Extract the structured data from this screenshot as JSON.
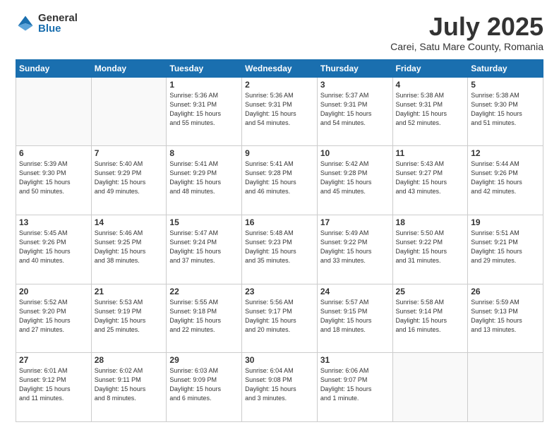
{
  "logo": {
    "general": "General",
    "blue": "Blue"
  },
  "header": {
    "month": "July 2025",
    "location": "Carei, Satu Mare County, Romania"
  },
  "weekdays": [
    "Sunday",
    "Monday",
    "Tuesday",
    "Wednesday",
    "Thursday",
    "Friday",
    "Saturday"
  ],
  "weeks": [
    [
      {
        "day": "",
        "info": ""
      },
      {
        "day": "",
        "info": ""
      },
      {
        "day": "1",
        "info": "Sunrise: 5:36 AM\nSunset: 9:31 PM\nDaylight: 15 hours\nand 55 minutes."
      },
      {
        "day": "2",
        "info": "Sunrise: 5:36 AM\nSunset: 9:31 PM\nDaylight: 15 hours\nand 54 minutes."
      },
      {
        "day": "3",
        "info": "Sunrise: 5:37 AM\nSunset: 9:31 PM\nDaylight: 15 hours\nand 54 minutes."
      },
      {
        "day": "4",
        "info": "Sunrise: 5:38 AM\nSunset: 9:31 PM\nDaylight: 15 hours\nand 52 minutes."
      },
      {
        "day": "5",
        "info": "Sunrise: 5:38 AM\nSunset: 9:30 PM\nDaylight: 15 hours\nand 51 minutes."
      }
    ],
    [
      {
        "day": "6",
        "info": "Sunrise: 5:39 AM\nSunset: 9:30 PM\nDaylight: 15 hours\nand 50 minutes."
      },
      {
        "day": "7",
        "info": "Sunrise: 5:40 AM\nSunset: 9:29 PM\nDaylight: 15 hours\nand 49 minutes."
      },
      {
        "day": "8",
        "info": "Sunrise: 5:41 AM\nSunset: 9:29 PM\nDaylight: 15 hours\nand 48 minutes."
      },
      {
        "day": "9",
        "info": "Sunrise: 5:41 AM\nSunset: 9:28 PM\nDaylight: 15 hours\nand 46 minutes."
      },
      {
        "day": "10",
        "info": "Sunrise: 5:42 AM\nSunset: 9:28 PM\nDaylight: 15 hours\nand 45 minutes."
      },
      {
        "day": "11",
        "info": "Sunrise: 5:43 AM\nSunset: 9:27 PM\nDaylight: 15 hours\nand 43 minutes."
      },
      {
        "day": "12",
        "info": "Sunrise: 5:44 AM\nSunset: 9:26 PM\nDaylight: 15 hours\nand 42 minutes."
      }
    ],
    [
      {
        "day": "13",
        "info": "Sunrise: 5:45 AM\nSunset: 9:26 PM\nDaylight: 15 hours\nand 40 minutes."
      },
      {
        "day": "14",
        "info": "Sunrise: 5:46 AM\nSunset: 9:25 PM\nDaylight: 15 hours\nand 38 minutes."
      },
      {
        "day": "15",
        "info": "Sunrise: 5:47 AM\nSunset: 9:24 PM\nDaylight: 15 hours\nand 37 minutes."
      },
      {
        "day": "16",
        "info": "Sunrise: 5:48 AM\nSunset: 9:23 PM\nDaylight: 15 hours\nand 35 minutes."
      },
      {
        "day": "17",
        "info": "Sunrise: 5:49 AM\nSunset: 9:22 PM\nDaylight: 15 hours\nand 33 minutes."
      },
      {
        "day": "18",
        "info": "Sunrise: 5:50 AM\nSunset: 9:22 PM\nDaylight: 15 hours\nand 31 minutes."
      },
      {
        "day": "19",
        "info": "Sunrise: 5:51 AM\nSunset: 9:21 PM\nDaylight: 15 hours\nand 29 minutes."
      }
    ],
    [
      {
        "day": "20",
        "info": "Sunrise: 5:52 AM\nSunset: 9:20 PM\nDaylight: 15 hours\nand 27 minutes."
      },
      {
        "day": "21",
        "info": "Sunrise: 5:53 AM\nSunset: 9:19 PM\nDaylight: 15 hours\nand 25 minutes."
      },
      {
        "day": "22",
        "info": "Sunrise: 5:55 AM\nSunset: 9:18 PM\nDaylight: 15 hours\nand 22 minutes."
      },
      {
        "day": "23",
        "info": "Sunrise: 5:56 AM\nSunset: 9:17 PM\nDaylight: 15 hours\nand 20 minutes."
      },
      {
        "day": "24",
        "info": "Sunrise: 5:57 AM\nSunset: 9:15 PM\nDaylight: 15 hours\nand 18 minutes."
      },
      {
        "day": "25",
        "info": "Sunrise: 5:58 AM\nSunset: 9:14 PM\nDaylight: 15 hours\nand 16 minutes."
      },
      {
        "day": "26",
        "info": "Sunrise: 5:59 AM\nSunset: 9:13 PM\nDaylight: 15 hours\nand 13 minutes."
      }
    ],
    [
      {
        "day": "27",
        "info": "Sunrise: 6:01 AM\nSunset: 9:12 PM\nDaylight: 15 hours\nand 11 minutes."
      },
      {
        "day": "28",
        "info": "Sunrise: 6:02 AM\nSunset: 9:11 PM\nDaylight: 15 hours\nand 8 minutes."
      },
      {
        "day": "29",
        "info": "Sunrise: 6:03 AM\nSunset: 9:09 PM\nDaylight: 15 hours\nand 6 minutes."
      },
      {
        "day": "30",
        "info": "Sunrise: 6:04 AM\nSunset: 9:08 PM\nDaylight: 15 hours\nand 3 minutes."
      },
      {
        "day": "31",
        "info": "Sunrise: 6:06 AM\nSunset: 9:07 PM\nDaylight: 15 hours\nand 1 minute."
      },
      {
        "day": "",
        "info": ""
      },
      {
        "day": "",
        "info": ""
      }
    ]
  ]
}
